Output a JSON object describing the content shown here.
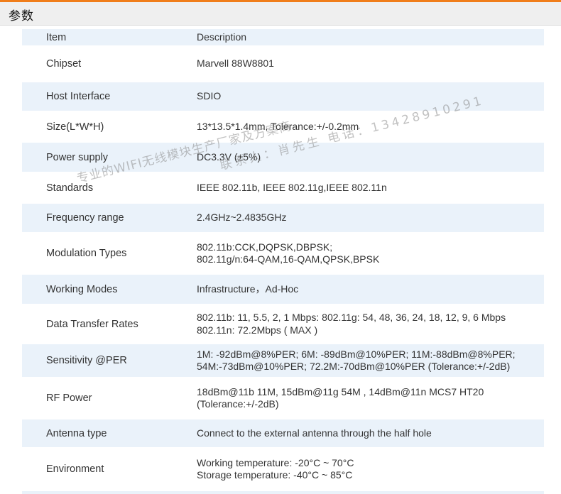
{
  "header": {
    "title": "参数"
  },
  "table": {
    "header": {
      "item": "Item",
      "description": "Description"
    },
    "rows": [
      {
        "item": "Chipset",
        "lines": [
          "Marvell 88W8801"
        ]
      },
      {
        "item": "Host Interface",
        "lines": [
          "SDIO"
        ]
      },
      {
        "item": "Size(L*W*H)",
        "lines": [
          "13*13.5*1.4mm, Tolerance:+/-0.2mm"
        ]
      },
      {
        "item": "Power supply",
        "lines": [
          "DC3.3V (±5%)"
        ]
      },
      {
        "item": "Standards",
        "lines": [
          "IEEE 802.11b, IEEE 802.11g,IEEE 802.11n"
        ]
      },
      {
        "item": "Frequency range",
        "lines": [
          "2.4GHz~2.4835GHz"
        ]
      },
      {
        "item": "Modulation Types",
        "lines": [
          "802.11b:CCK,DQPSK,DBPSK;",
          "802.11g/n:64-QAM,16-QAM,QPSK,BPSK"
        ]
      },
      {
        "item": "Working Modes",
        "lines": [
          "Infrastructure，Ad-Hoc"
        ]
      },
      {
        "item": "Data Transfer Rates",
        "lines": [
          "802.11b: 11, 5.5, 2, 1 Mbps: 802.11g: 54, 48, 36, 24, 18, 12, 9, 6 Mbps",
          "802.11n: 72.2Mbps ( MAX )"
        ]
      },
      {
        "item": "Sensitivity @PER",
        "lines": [
          "1M: -92dBm@8%PER; 6M: -89dBm@10%PER; 11M:-88dBm@8%PER;",
          "54M:-73dBm@10%PER; 72.2M:-70dBm@10%PER  (Tolerance:+/-2dB)"
        ]
      },
      {
        "item": "RF Power",
        "lines": [
          "18dBm@11b 11M, 15dBm@11g 54M , 14dBm@11n MCS7 HT20",
          "(Tolerance:+/-2dB)"
        ]
      },
      {
        "item": "Antenna type",
        "lines": [
          "Connect to the external antenna through the half hole"
        ]
      },
      {
        "item": "Environment",
        "lines": [
          "Working temperature: -20°C ~ 70°C",
          "Storage temperature: -40°C ~ 85°C"
        ]
      }
    ]
  },
  "watermark": {
    "line1": "专业的WIFI无线模块生产厂家及方案商",
    "line2": "联系人：肖先生 电话：13428910291"
  }
}
